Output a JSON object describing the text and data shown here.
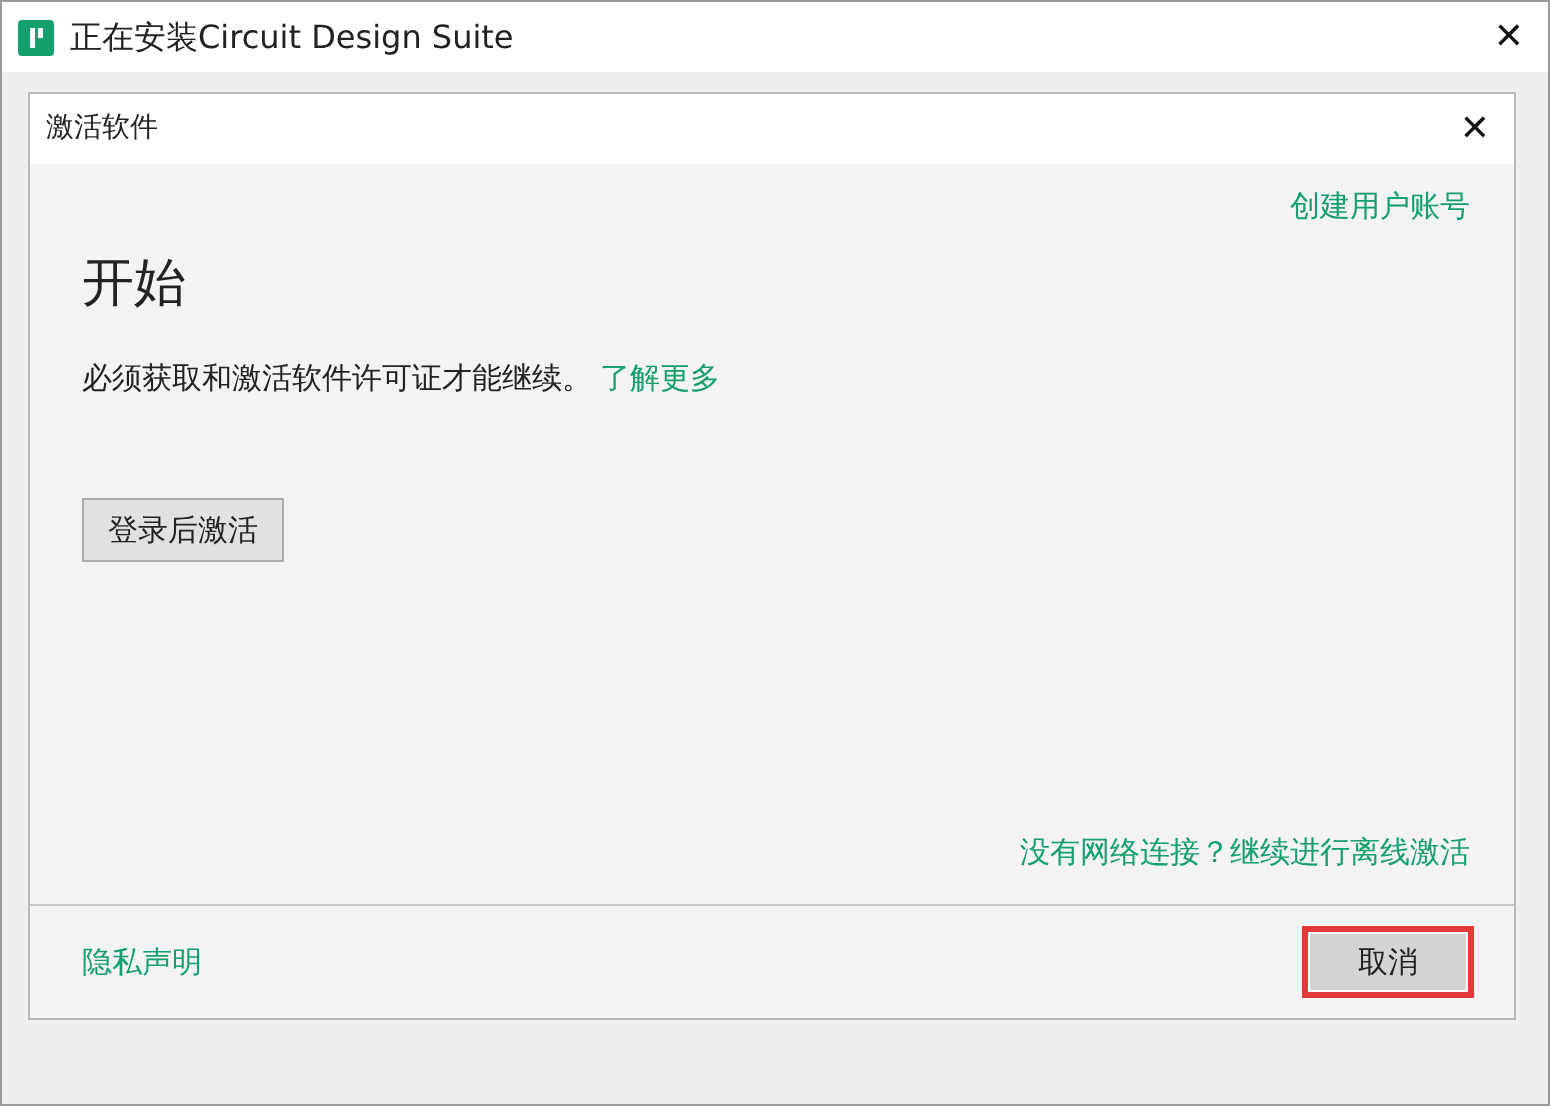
{
  "window": {
    "title": "正在安装Circuit Design Suite",
    "close": "✕"
  },
  "dialog": {
    "title": "激活软件",
    "close": "✕",
    "create_account_link": "创建用户账号",
    "heading": "开始",
    "message": "必须获取和激活软件许可证才能继续。",
    "learn_more_link": "了解更多",
    "sign_in_button": "登录后激活",
    "offline_link": "没有网络连接？继续进行离线激活",
    "privacy_link": "隐私声明",
    "cancel_button": {
      "label": "取消",
      "highlighted": true
    }
  }
}
